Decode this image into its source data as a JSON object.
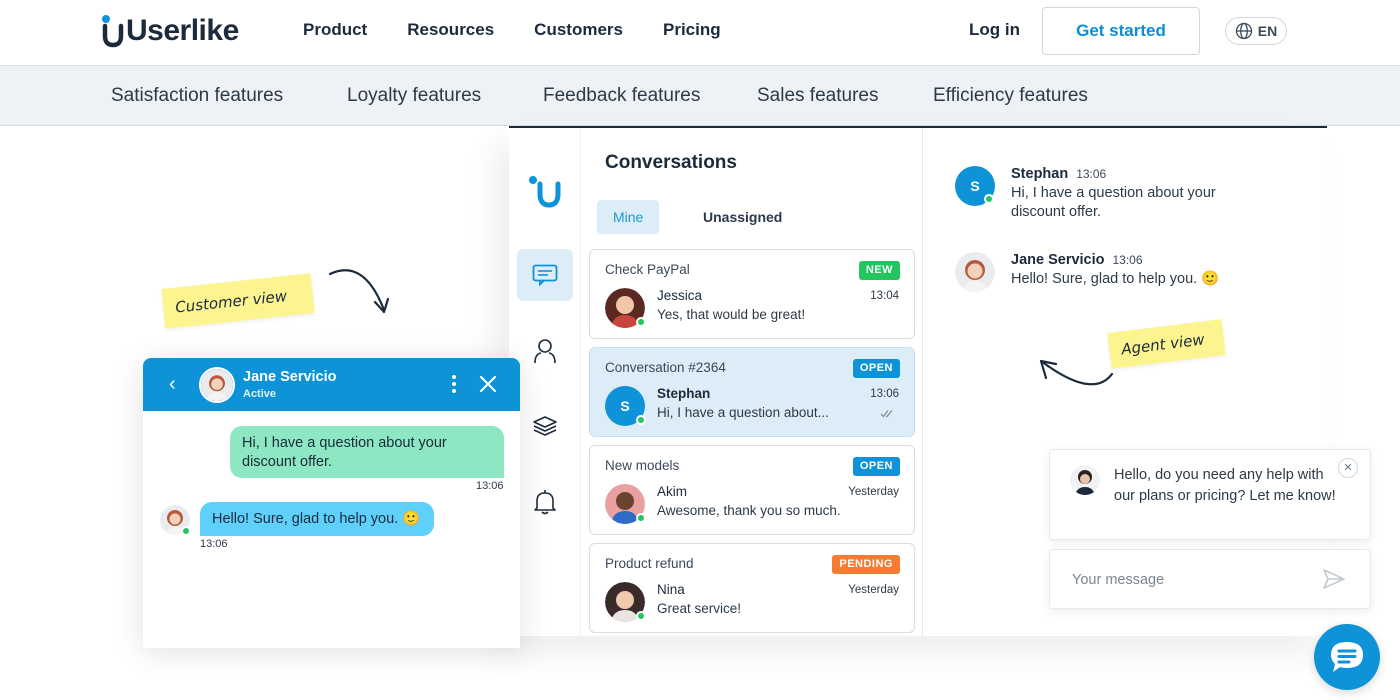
{
  "header": {
    "logo_text": "Userlike",
    "nav": [
      "Product",
      "Resources",
      "Customers",
      "Pricing"
    ],
    "login": "Log in",
    "cta": "Get started",
    "language": "EN"
  },
  "subnav": [
    "Satisfaction features",
    "Loyalty features",
    "Feedback features",
    "Sales features",
    "Efficiency features"
  ],
  "agent_panel": {
    "title": "Conversations",
    "tabs": {
      "mine": "Mine",
      "unassigned": "Unassigned"
    },
    "conversations": [
      {
        "subject": "Check PayPal",
        "status": "NEW",
        "status_color": "#22c55e",
        "name": "Jessica",
        "time": "13:04",
        "message": "Yes, that would be great!",
        "avatar_color": "#c9463d"
      },
      {
        "subject": "Conversation #2364",
        "status": "OPEN",
        "status_color": "#0e93d8",
        "name": "Stephan",
        "time": "13:06",
        "message": "Hi, I have a question about...",
        "avatar_initial": "S",
        "avatar_color": "#0e93d8"
      },
      {
        "subject": "New models",
        "status": "OPEN",
        "status_color": "#0e93d8",
        "name": "Akim",
        "time": "Yesterday",
        "message": "Awesome, thank you so much.",
        "avatar_color": "#6b4430"
      },
      {
        "subject": "Product refund",
        "status": "PENDING",
        "status_color": "#f47b30",
        "name": "Nina",
        "time": "Yesterday",
        "message": "Great service!",
        "avatar_color": "#3b2a2a"
      }
    ],
    "chat": [
      {
        "name": "Stephan",
        "time": "13:06",
        "text": "Hi, I have a question about your discount offer.",
        "avatar_initial": "S"
      },
      {
        "name": "Jane Servicio",
        "time": "13:06",
        "text": "Hello! Sure, glad to help you. 🙂"
      }
    ]
  },
  "customer_widget": {
    "agent_name": "Jane Servicio",
    "agent_status": "Active",
    "outgoing": {
      "text": "Hi, I have a question about your discount offer.",
      "time": "13:06"
    },
    "incoming": {
      "text": "Hello! Sure, glad to help you. 🙂",
      "time": "13:06"
    }
  },
  "notes": {
    "customer": "Customer view",
    "agent": "Agent view"
  },
  "invite": {
    "text": "Hello, do you need any help with our plans or pricing? Let me know!",
    "placeholder": "Your message"
  },
  "colors": {
    "accent": "#0e93d8",
    "outgoing_bubble": "#8de7c2",
    "incoming_bubble": "#5fd0fb",
    "note": "#fbf48f"
  }
}
